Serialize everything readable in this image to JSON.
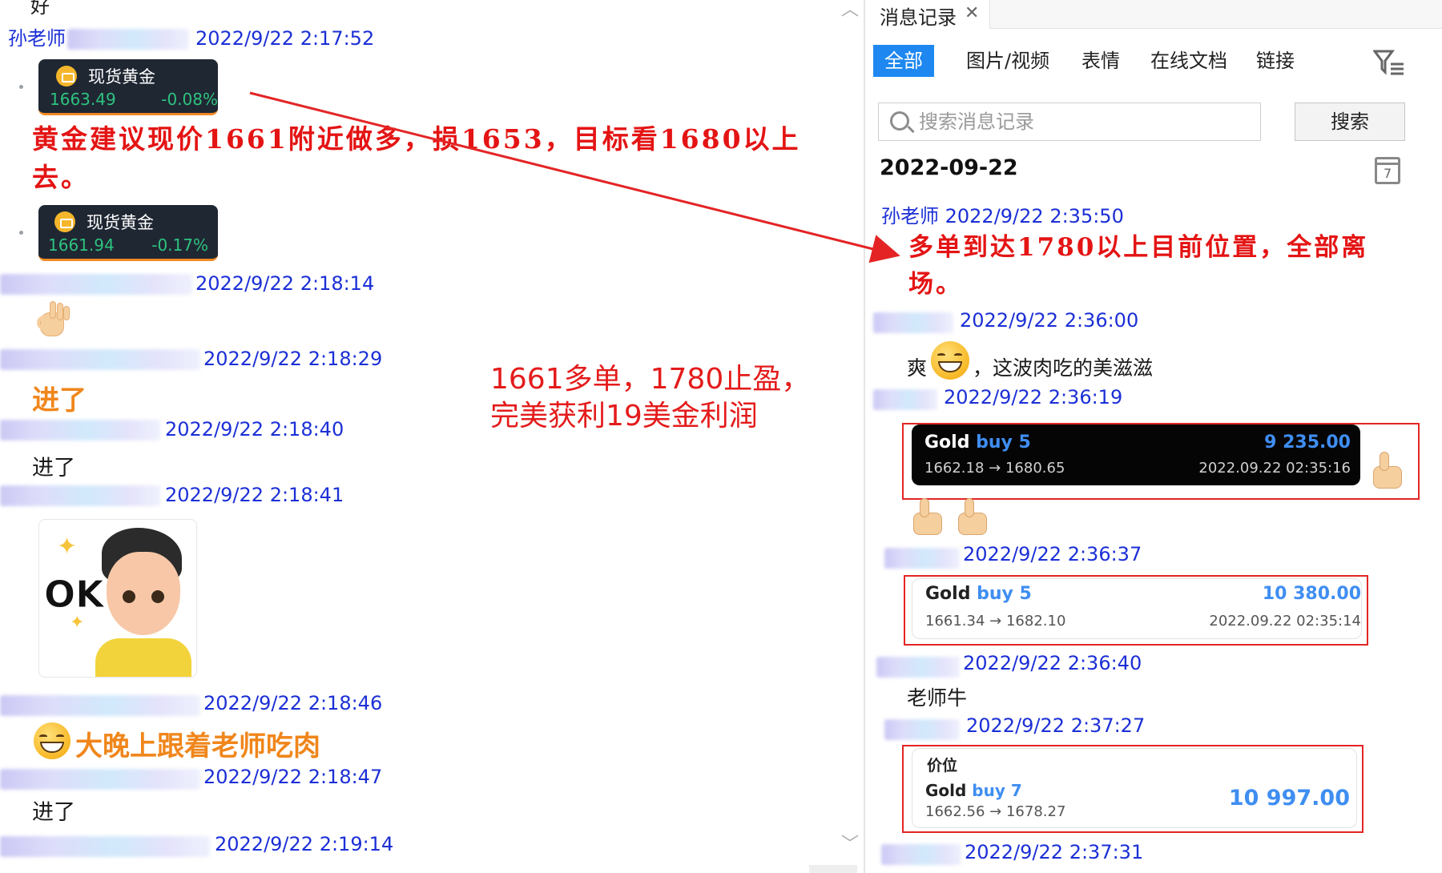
{
  "left": {
    "top_partial": "好",
    "teacher_name": "孙老师",
    "messages": [
      {
        "time": "2022/9/22 2:17:52"
      },
      {
        "time": "2022/9/22 2:18:14"
      },
      {
        "time": "2022/9/22 2:18:29"
      },
      {
        "time": "2022/9/22 2:18:40"
      },
      {
        "time": "2022/9/22 2:18:41"
      },
      {
        "time": "2022/9/22 2:18:46"
      },
      {
        "time": "2022/9/22 2:18:47"
      },
      {
        "time": "2022/9/22 2:19:14"
      }
    ],
    "quote1": {
      "name": "现货黄金",
      "price": "1663.49",
      "change": "-0.08%"
    },
    "quote2": {
      "name": "现货黄金",
      "price": "1661.94",
      "change": "-0.17%"
    },
    "advice": "黄金建议现价1661附近做多，损1653，目标看1680以上去。",
    "msg_jinle_orange": "进了",
    "msg_jinle_plain": "进了",
    "sticker_text": "OK",
    "msg_dawan": "大晚上跟着老师吃肉",
    "msg_jinle_last": "进了",
    "annotation_line1": "1661多单，1780止盈，",
    "annotation_line2": "完美获利19美金利润"
  },
  "right": {
    "tab_title": "消息记录",
    "filters": [
      "全部",
      "图片/视频",
      "表情",
      "在线文档",
      "链接"
    ],
    "search_placeholder": "搜索消息记录",
    "search_button": "搜索",
    "date_heading": "2022-09-22",
    "calendar_day": "7",
    "teacher_line": "孙老师 2022/9/22 2:35:50",
    "teacher_msg": "多单到达1780以上目前位置，全部离场。",
    "times": [
      "2022/9/22 2:36:00",
      "2022/9/22 2:36:19",
      "2022/9/22 2:36:37",
      "2022/9/22 2:36:40",
      "2022/9/22 2:37:27",
      "2022/9/22 2:37:31"
    ],
    "msg_shuang_prefix": "爽",
    "msg_shuang_suffix": "，这波肉吃的美滋滋",
    "msg_laoshi": "老师牛",
    "trade1": {
      "symbol": "Gold",
      "dir": "buy 5",
      "profit": "9 235.00",
      "prices": "1662.18 → 1680.65",
      "time": "2022.09.22 02:35:16"
    },
    "trade2": {
      "symbol": "Gold",
      "dir": "buy 5",
      "profit": "10 380.00",
      "prices": "1661.34 → 1682.10",
      "time": "2022.09.22 02:35:14"
    },
    "trade3": {
      "label": "价位",
      "symbol": "Gold",
      "dir": "buy 7",
      "profit": "10 997.00",
      "prices": "1662.56 → 1678.27"
    }
  },
  "colors": {
    "link_blue": "#1b2fd6",
    "annot_red": "#e41b1b",
    "accent_blue": "#1e88f0",
    "orange": "#f0861b"
  }
}
